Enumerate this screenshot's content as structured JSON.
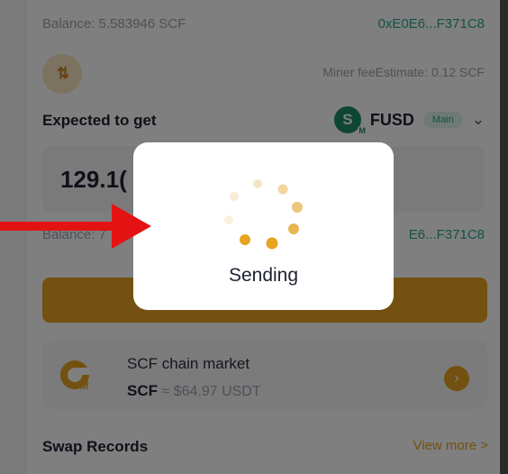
{
  "swap": {
    "from_balance": "Balance: 5.583946 SCF",
    "from_address": "0xE0E6...F371C8",
    "miner_fee": "Miner feeEstimate: 0.12 SCF",
    "expected_label": "Expected to get",
    "token_symbol": "FUSD",
    "token_icon_letter": "S",
    "token_icon_sub": "M",
    "network_badge": "Main",
    "expected_amount": "129.1(",
    "to_balance": "Balance: 7",
    "to_address": "E6...F371C8"
  },
  "market": {
    "title": "SCF chain market",
    "symbol": "SCF",
    "price": "≈ $64.97 USDT"
  },
  "records": {
    "label": "Swap Records",
    "view_more": "View more >"
  },
  "toast": {
    "label": "Sending"
  },
  "colors": {
    "accent": "#e7a321",
    "teal": "#2aa58c",
    "arrow": "#e41313"
  }
}
